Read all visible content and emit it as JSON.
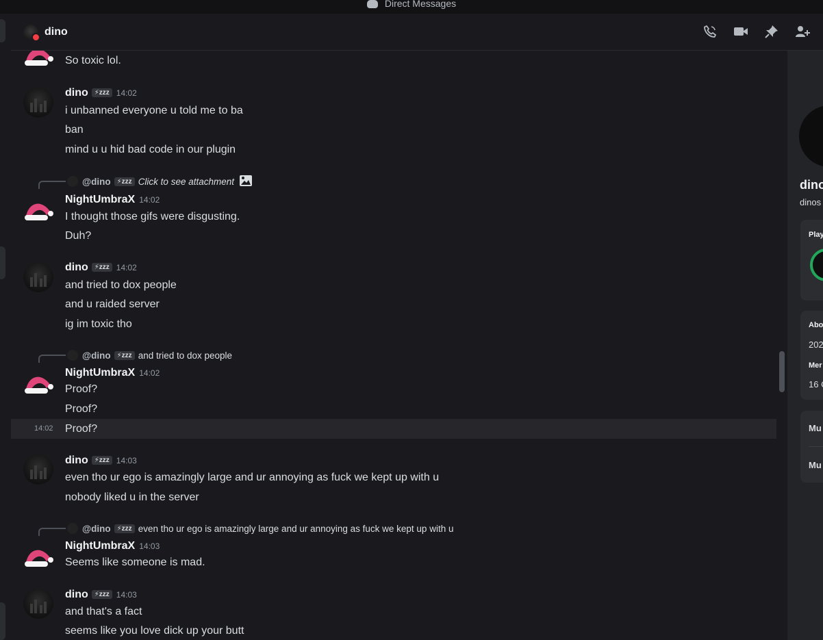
{
  "titlebar": {
    "title": "Direct Messages"
  },
  "header": {
    "name": "dino"
  },
  "badges": {
    "dino_tag": "⚡zzz"
  },
  "messages": {
    "m0": {
      "lines": [
        "So toxic lol."
      ]
    },
    "m1": {
      "author": "dino",
      "time": "14:02",
      "lines": [
        "i unbanned everyone u told me to ba",
        "ban",
        "mind u u hid bad code in our plugin"
      ]
    },
    "m2": {
      "reply_to": "@dino",
      "reply_text": "Click to see attachment",
      "author": "NightUmbraX",
      "time": "14:02",
      "lines": [
        "I thought those gifs were disgusting.",
        "Duh?"
      ]
    },
    "m3": {
      "author": "dino",
      "time": "14:02",
      "lines": [
        "and tried to dox people",
        "and u raided server",
        "ig im toxic tho"
      ]
    },
    "m4": {
      "reply_to": "@dino",
      "reply_text": "and tried to dox people",
      "author": "NightUmbraX",
      "time": "14:02",
      "lines": [
        "Proof?",
        "Proof?",
        "Proof?"
      ],
      "hover_time": "14:02"
    },
    "m5": {
      "author": "dino",
      "time": "14:03",
      "lines": [
        "even tho ur ego is amazingly large and ur annoying as fuck we kept up with u",
        "nobody liked u in the server"
      ]
    },
    "m6": {
      "reply_to": "@dino",
      "reply_text": "even tho ur ego is amazingly large and ur annoying as fuck we kept up with u",
      "author": "NightUmbraX",
      "time": "14:03",
      "lines": [
        "Seems like someone is mad."
      ]
    },
    "m7": {
      "author": "dino",
      "time": "14:03",
      "lines": [
        "and that's a fact",
        "seems like you love dick up your butt"
      ]
    }
  },
  "right_panel": {
    "name_partial": "dino",
    "username_partial": "dinos",
    "playing_label": "Play",
    "about_label": "Abo",
    "about_value": "202",
    "member_label": "Mer",
    "member_value": "16 C",
    "mutual1": "Mu",
    "mutual2": "Mu"
  }
}
